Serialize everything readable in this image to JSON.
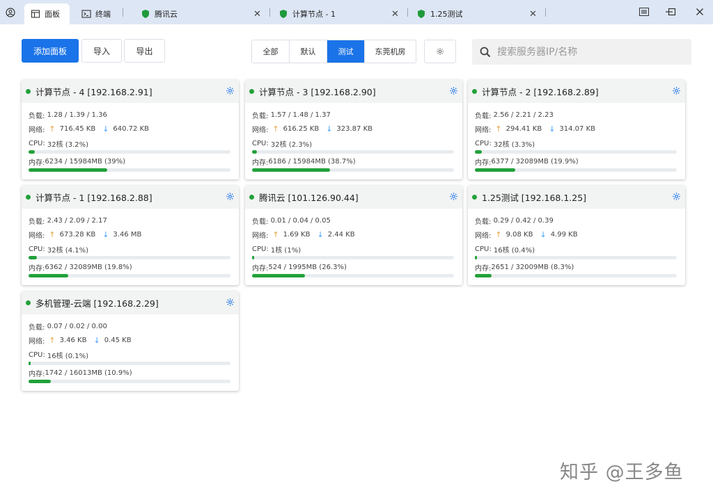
{
  "tabs": [
    {
      "label": "面板",
      "icon": "panel-icon",
      "active": true
    },
    {
      "label": "终端",
      "icon": "terminal-icon",
      "active": false
    },
    {
      "label": "腾讯云",
      "icon": "shield-icon",
      "active": false
    },
    {
      "label": "计算节点 - 1",
      "icon": "shield-icon",
      "active": false
    },
    {
      "label": "1.25测试",
      "icon": "shield-icon",
      "active": false
    }
  ],
  "window_controls": {
    "menu": "≡",
    "minimize": "—",
    "maximize": "□",
    "close": "✕"
  },
  "toolbar": {
    "add_label": "添加面板",
    "import_label": "导入",
    "export_label": "导出"
  },
  "groups": [
    "全部",
    "默认",
    "测试",
    "东莞机房"
  ],
  "active_group": "测试",
  "search": {
    "placeholder": "搜索服务器IP/名称"
  },
  "labels": {
    "load": "负载:",
    "net": "网络:",
    "cpu": "CPU:",
    "mem": "内存:"
  },
  "colors": {
    "accent": "#1a73e8",
    "online": "#22a13a",
    "up_arrow": "#e6a23c",
    "down_arrow": "#409eff"
  },
  "cards": [
    {
      "title": "计算节点 - 4 [192.168.2.91]",
      "load": "1.28 / 1.39 / 1.36",
      "up": "716.45 KB",
      "down": "640.72 KB",
      "cpu": "32核 (3.2%)",
      "cpu_pct": 3.2,
      "mem": "6234 / 15984MB (39%)",
      "mem_pct": 39
    },
    {
      "title": "计算节点 - 3 [192.168.2.90]",
      "load": "1.57 / 1.48 / 1.37",
      "up": "616.25 KB",
      "down": "323.87 KB",
      "cpu": "32核 (2.3%)",
      "cpu_pct": 2.3,
      "mem": "6186 / 15984MB (38.7%)",
      "mem_pct": 38.7
    },
    {
      "title": "计算节点 - 2 [192.168.2.89]",
      "load": "2.56 / 2.21 / 2.23",
      "up": "294.41 KB",
      "down": "314.07 KB",
      "cpu": "32核 (3.3%)",
      "cpu_pct": 3.3,
      "mem": "6377 / 32089MB (19.9%)",
      "mem_pct": 19.9
    },
    {
      "title": "计算节点 - 1 [192.168.2.88]",
      "load": "2.43 / 2.09 / 2.17",
      "up": "673.28 KB",
      "down": "3.46 MB",
      "cpu": "32核 (4.1%)",
      "cpu_pct": 4.1,
      "mem": "6362 / 32089MB (19.8%)",
      "mem_pct": 19.8
    },
    {
      "title": "腾讯云 [101.126.90.44]",
      "load": "0.01 / 0.04 / 0.05",
      "up": "1.69 KB",
      "down": "2.44 KB",
      "cpu": "1核 (1%)",
      "cpu_pct": 1,
      "mem": "524 / 1995MB (26.3%)",
      "mem_pct": 26.3
    },
    {
      "title": "1.25测试 [192.168.1.25]",
      "load": "0.29 / 0.42 / 0.39",
      "up": "9.08 KB",
      "down": "4.99 KB",
      "cpu": "16核 (0.4%)",
      "cpu_pct": 0.4,
      "mem": "2651 / 32009MB (8.3%)",
      "mem_pct": 8.3
    },
    {
      "title": "多机管理-云端 [192.168.2.29]",
      "load": "0.07 / 0.02 / 0.00",
      "up": "3.46 KB",
      "down": "0.45 KB",
      "cpu": "16核 (0.1%)",
      "cpu_pct": 0.1,
      "mem": "1742 / 16013MB (10.9%)",
      "mem_pct": 10.9
    }
  ],
  "watermark": "知乎 @王多鱼"
}
